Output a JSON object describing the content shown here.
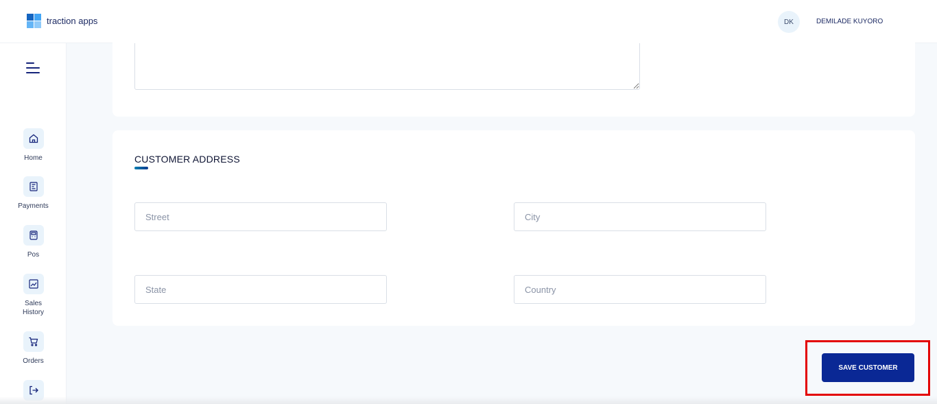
{
  "app": {
    "logo_text": "traction apps",
    "logo_colors": [
      "#1565c0",
      "#42a5f5",
      "#64b5f6",
      "#90caf9"
    ]
  },
  "user": {
    "initials": "DK",
    "name": "DEMILADE KUYORO"
  },
  "sidebar": {
    "items": [
      {
        "label": "Home",
        "icon": "home-icon"
      },
      {
        "label": "Payments",
        "icon": "payments-icon"
      },
      {
        "label": "Pos",
        "icon": "pos-icon"
      },
      {
        "label": "Sales\nHistory",
        "icon": "chart-icon"
      },
      {
        "label": "Orders",
        "icon": "cart-icon"
      },
      {
        "label": "",
        "icon": "logout-icon"
      }
    ]
  },
  "address": {
    "title": "CUSTOMER ADDRESS",
    "street_placeholder": "Street",
    "city_placeholder": "City",
    "state_placeholder": "State",
    "country_placeholder": "Country"
  },
  "actions": {
    "save_label": "SAVE CUSTOMER"
  },
  "colors": {
    "accent": "#0a2895",
    "highlight": "#e30000"
  }
}
